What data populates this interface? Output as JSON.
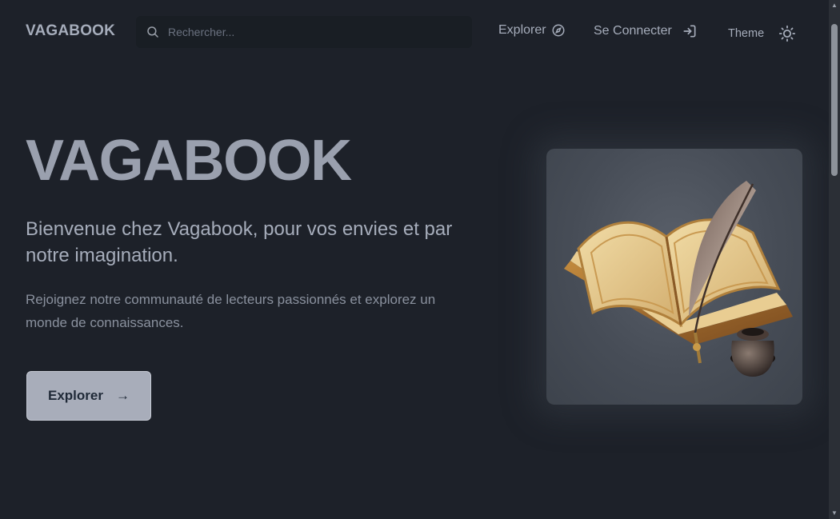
{
  "navbar": {
    "brand": "VAGABOOK",
    "search": {
      "placeholder": "Rechercher...",
      "value": "",
      "icon": "search-icon"
    },
    "explore_label": "Explorer",
    "explore_icon": "compass-icon",
    "login_label": "Se Connecter",
    "login_icon": "login-icon",
    "theme_label": "Theme",
    "theme_icon": "sun-icon"
  },
  "hero": {
    "title": "VAGABOOK",
    "subtitle": "Bienvenue chez Vagabook, pour vos envies et par notre imagination.",
    "description": "Rejoignez notre communauté de lecteurs passionnés et explorez un monde de connaissances.",
    "cta_label": "Explorer",
    "cta_arrow": "→",
    "image_icon": "open-book-with-quill-illustration"
  },
  "colors": {
    "background": "#1d2129",
    "text": "#a6adbb",
    "button": "#a8adba"
  }
}
